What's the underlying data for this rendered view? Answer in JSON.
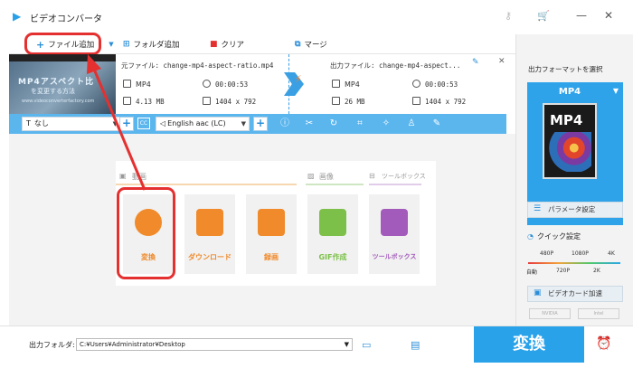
{
  "app": {
    "title": "ビデオコンバータ"
  },
  "toolbar": {
    "add_file": "ファイル追加",
    "add_folder": "フォルダ追加",
    "clear": "クリア",
    "merge": "マージ"
  },
  "task": {
    "thumb_title": "MP4アスペクト比",
    "thumb_sub": "を変更する方法",
    "thumb_url": "www.videoconverterfactory.com",
    "source_file": "元ファイル: change-mp4-aspect-ratio.mp4",
    "source_format": "MP4",
    "source_duration": "00:00:53",
    "source_size": "4.13 MB",
    "source_resolution": "1404 x 792",
    "output_file": "出力ファイル: change-mp4-aspect...",
    "output_format": "MP4",
    "output_duration": "00:00:53",
    "output_size": "26 MB",
    "output_resolution": "1404 x 792"
  },
  "options": {
    "subtitle": "なし",
    "audio": "English aac (LC)"
  },
  "sections": {
    "video": "動画",
    "image": "画像",
    "toolbox": "ツールボックス"
  },
  "tools": [
    {
      "label": "変換",
      "color": "#f08a2a"
    },
    {
      "label": "ダウンロード",
      "color": "#f08a2a"
    },
    {
      "label": "録画",
      "color": "#f08a2a"
    },
    {
      "label": "GIF作成",
      "color": "#7cc04a"
    },
    {
      "label": "ツールボックス",
      "color": "#a35bbb"
    }
  ],
  "right": {
    "select_title": "出力フォーマットを選択",
    "format": "MP4",
    "film_label": "MP4",
    "param_btn": "パラメータ設定",
    "quick_title": "クイック設定",
    "top_labels": [
      "480P",
      "1080P",
      "4K"
    ],
    "bottom_labels": [
      "自動",
      "720P",
      "2K"
    ],
    "gpu_btn": "ビデオカード加速",
    "gpu_nvidia": "NVIDIA",
    "gpu_intel": "Intel"
  },
  "bottom": {
    "folder_label": "出力フォルダ:",
    "folder_path": "C:¥Users¥Administrator¥Desktop",
    "convert": "変換"
  },
  "colors": {
    "accent": "#29a2ea",
    "highlight": "#e53030",
    "orange": "#f08a2a"
  }
}
